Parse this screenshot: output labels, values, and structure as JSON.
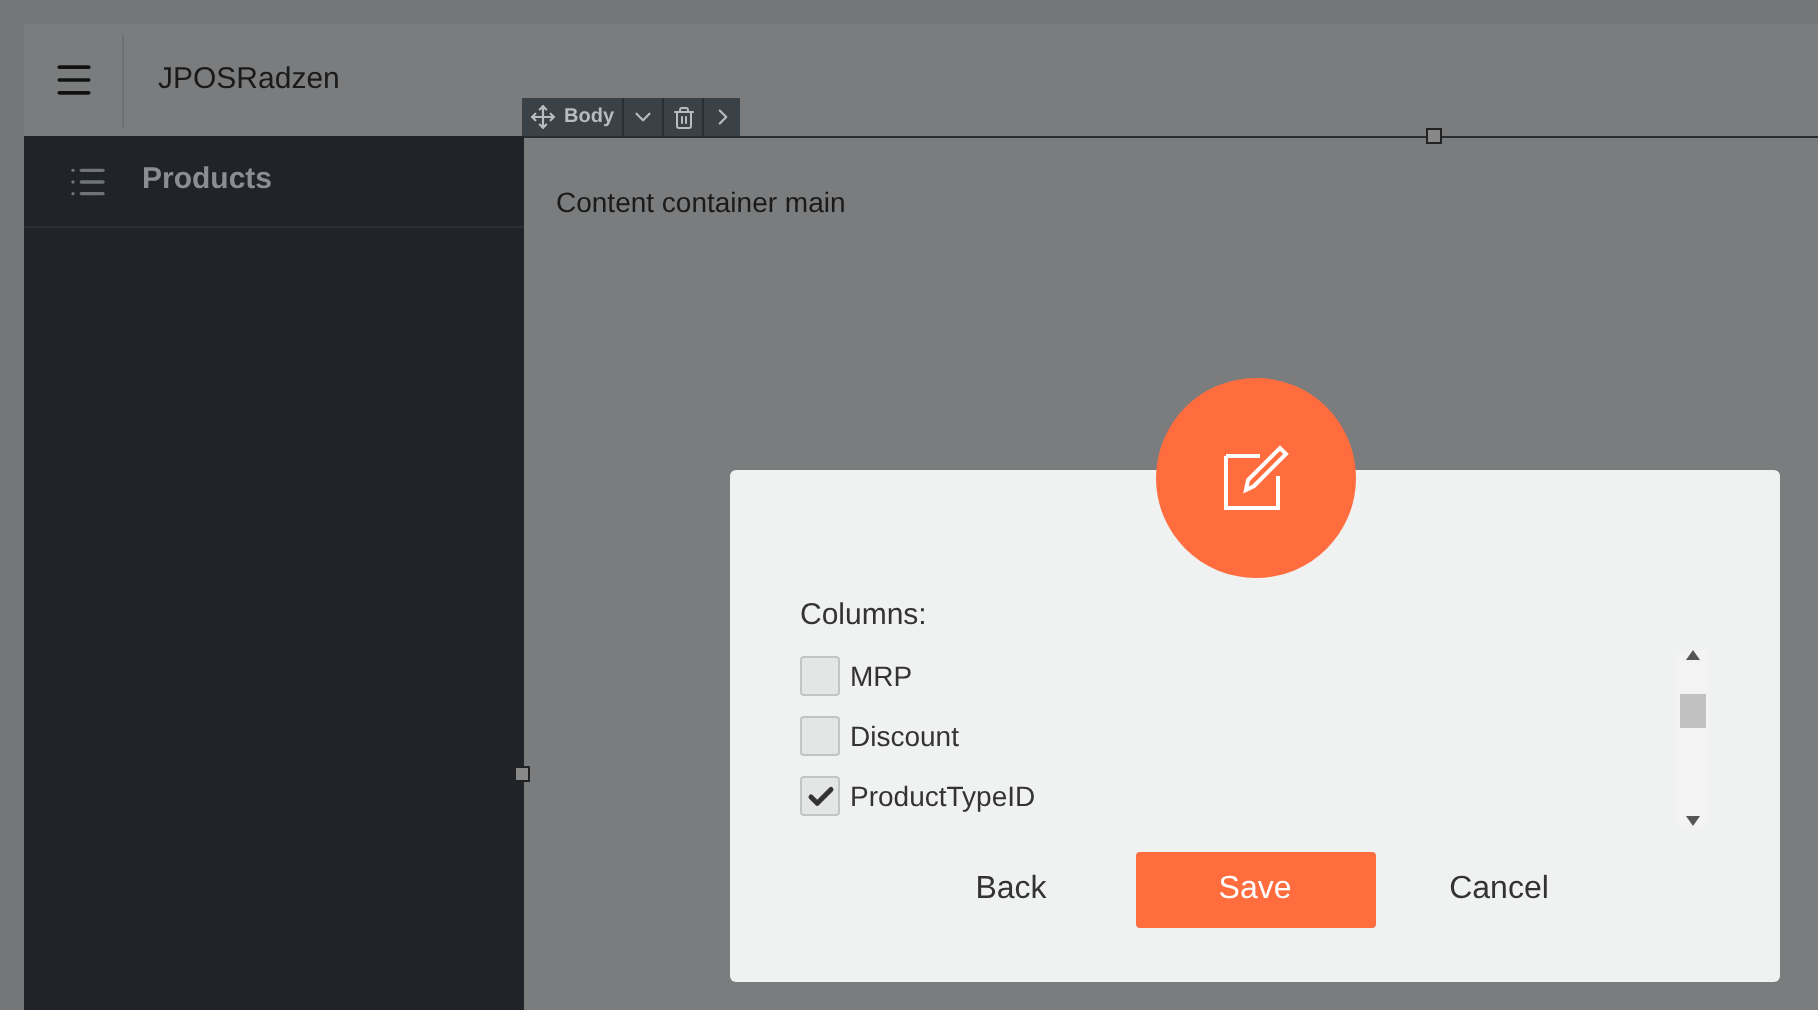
{
  "header": {
    "title": "JPOSRadzen"
  },
  "sidebar": {
    "items": [
      {
        "label": "Products",
        "selected": false
      }
    ]
  },
  "designer_toolbar": {
    "label": "Body"
  },
  "content": {
    "text": "Content container main"
  },
  "dialog": {
    "columns_label": "Columns:",
    "columns": [
      {
        "label": "MRP",
        "checked": false
      },
      {
        "label": "Discount",
        "checked": false
      },
      {
        "label": "ProductTypeID",
        "checked": true
      }
    ],
    "buttons": [
      {
        "label": "Back",
        "kind": "text"
      },
      {
        "label": "Save",
        "kind": "primary"
      },
      {
        "label": "Cancel",
        "kind": "text"
      }
    ]
  }
}
